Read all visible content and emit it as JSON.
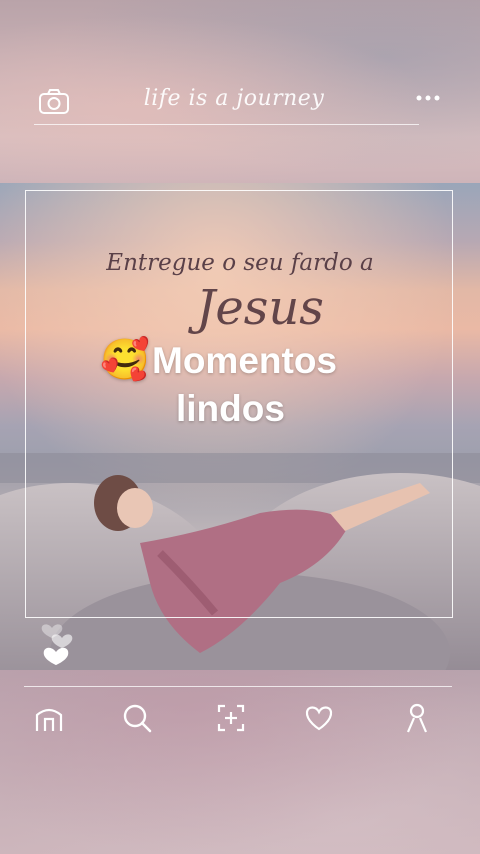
{
  "header": {
    "brand_text": "life is a journey",
    "camera_icon": "camera-icon",
    "more_icon": "more-dots-icon"
  },
  "post": {
    "image_text_line1": "Entregue o seu fardo a",
    "image_text_line2": "Jesus",
    "caption_emoji": "🥰",
    "caption_line1": "Momentos",
    "caption_line2": "lindos"
  },
  "bottom_nav": {
    "items": [
      {
        "icon": "home-icon"
      },
      {
        "icon": "search-icon"
      },
      {
        "icon": "add-post-icon"
      },
      {
        "icon": "heart-icon"
      },
      {
        "icon": "profile-icon"
      }
    ]
  },
  "colors": {
    "line": "#ffffff",
    "caption_text": "#ffffff",
    "quote_text": "#5a4048"
  }
}
